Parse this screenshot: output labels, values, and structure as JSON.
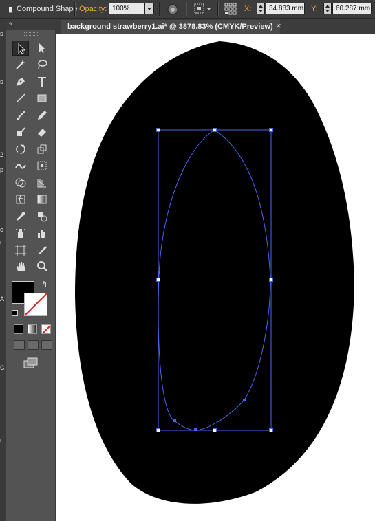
{
  "control_bar": {
    "selection_type": "Compound Shape",
    "opacity_label": "Opacity:",
    "opacity_value": "100%",
    "x_label": "X:",
    "x_value": "34.883 mm",
    "y_label": "Y:",
    "y_value": "60.287 mm"
  },
  "left_edge_fragments": [
    "s",
    "s",
    "2",
    "p",
    "c",
    "r",
    "A",
    "C",
    "r"
  ],
  "document_tab": {
    "title": "background strawberry1.ai* @ 3878.83% (CMYK/Preview)",
    "close": "×"
  },
  "colors": {
    "fill": "#000000",
    "stroke": "none",
    "path_highlight": "#4668f0",
    "ui_panel": "#535353",
    "ui_bar": "#3c3c3c"
  },
  "tools": [
    "selection-tool",
    "direct-selection-tool",
    "magic-wand-tool",
    "lasso-tool",
    "pen-tool",
    "type-tool",
    "line-segment-tool",
    "rectangle-tool",
    "paintbrush-tool",
    "pencil-tool",
    "blob-brush-tool",
    "eraser-tool",
    "rotate-tool",
    "scale-tool",
    "width-tool",
    "free-transform-tool",
    "shape-builder-tool",
    "perspective-grid-tool",
    "mesh-tool",
    "gradient-tool",
    "eyedropper-tool",
    "blend-tool",
    "symbol-sprayer-tool",
    "column-graph-tool",
    "artboard-tool",
    "slice-tool",
    "hand-tool",
    "zoom-tool"
  ]
}
